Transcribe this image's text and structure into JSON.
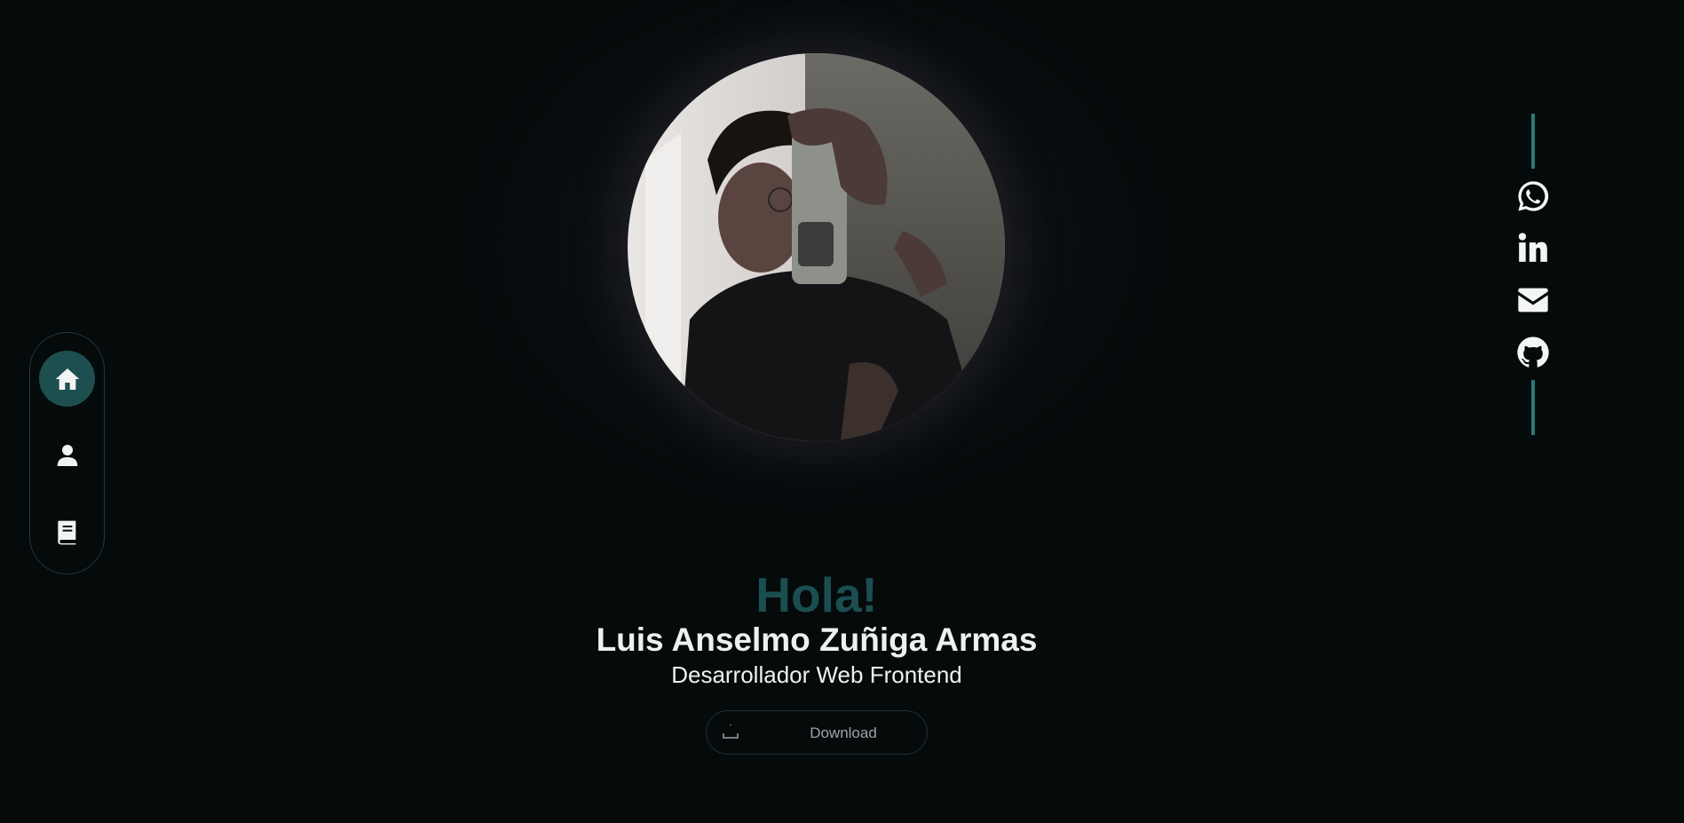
{
  "nav": {
    "items": [
      {
        "label": "home",
        "icon": "home-icon",
        "active": true
      },
      {
        "label": "about",
        "icon": "user-icon",
        "active": false
      },
      {
        "label": "projects",
        "icon": "book-icon",
        "active": false
      }
    ]
  },
  "social": {
    "links": [
      {
        "icon": "whatsapp-icon"
      },
      {
        "icon": "linkedin-icon"
      },
      {
        "icon": "email-icon"
      },
      {
        "icon": "github-icon"
      }
    ]
  },
  "hero": {
    "greeting": "Hola!",
    "name": "Luis Anselmo Zuñiga Armas",
    "role": "Desarrollador Web Frontend",
    "download_label": "Download"
  },
  "colors": {
    "background": "#050a0b",
    "accent": "#1d4f50",
    "accent_line": "#2b7a7a",
    "text": "#eef1f1"
  }
}
